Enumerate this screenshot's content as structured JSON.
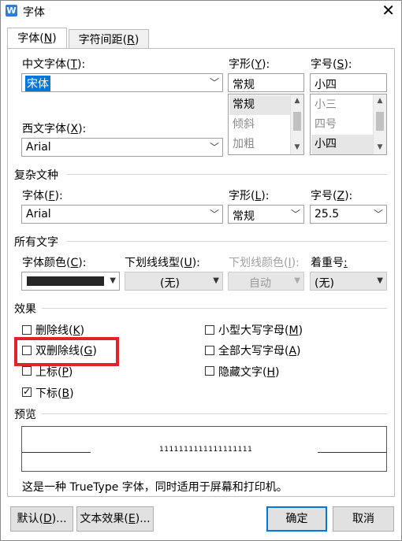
{
  "window": {
    "title": "字体",
    "app_icon": "W",
    "close_glyph": "✕"
  },
  "tabs": [
    {
      "label": "字体(",
      "key": "N",
      "suffix": ")"
    },
    {
      "label": "字符间距(",
      "key": "R",
      "suffix": ")"
    }
  ],
  "chinese_font": {
    "label_pre": "中文字体(",
    "key": "T",
    "label_post": "):",
    "value": "宋体"
  },
  "western_font": {
    "label_pre": "西文字体(",
    "key": "X",
    "label_post": "):",
    "value": "Arial"
  },
  "style": {
    "label_pre": "字形(",
    "key": "Y",
    "label_post": "):",
    "value": "常规",
    "options": [
      "常规",
      "倾斜",
      "加粗"
    ]
  },
  "size": {
    "label_pre": "字号(",
    "key": "S",
    "label_post": "):",
    "value": "小四",
    "options": [
      "小三",
      "四号",
      "小四"
    ]
  },
  "complex": {
    "section": "复杂文种",
    "font_label_pre": "字体(",
    "font_key": "F",
    "font_label_post": "):",
    "font_value": "Arial",
    "style_label_pre": "字形(",
    "style_key": "L",
    "style_label_post": "):",
    "style_value": "常规",
    "size_label_pre": "字号(",
    "size_key": "Z",
    "size_label_post": "):",
    "size_value": "25.5"
  },
  "all_text": {
    "section": "所有文字",
    "color_label_pre": "字体颜色(",
    "color_key": "C",
    "color_label_post": "):",
    "color_value": "#262626",
    "underline_type_label_pre": "下划线线型(",
    "underline_type_key": "U",
    "underline_type_label_post": "):",
    "underline_type_value": "(无)",
    "underline_color_label_pre": "下划线颜色(",
    "underline_color_key": "I",
    "underline_color_label_post": "):",
    "underline_color_value": "自动",
    "emphasis_label_pre": "着重号",
    "emphasis_key": ":",
    "emphasis_value": "(无)"
  },
  "effects": {
    "section": "效果",
    "items": [
      {
        "pre": "删除线(",
        "key": "K",
        "post": ")",
        "checked": false
      },
      {
        "pre": "双删除线(",
        "key": "G",
        "post": ")",
        "checked": false
      },
      {
        "pre": "上标(",
        "key": "P",
        "post": ")",
        "checked": false
      },
      {
        "pre": "下标(",
        "key": "B",
        "post": ")",
        "checked": true
      },
      {
        "pre": "小型大写字母(",
        "key": "M",
        "post": ")",
        "checked": false
      },
      {
        "pre": "全部大写字母(",
        "key": "A",
        "post": ")",
        "checked": false
      },
      {
        "pre": "隐藏文字(",
        "key": "H",
        "post": ")",
        "checked": false
      }
    ]
  },
  "preview": {
    "section": "预览",
    "sample": "1111111111111111111",
    "note": "这是一种 TrueType 字体，同时适用于屏幕和打印机。"
  },
  "buttons": {
    "default_pre": "默认(",
    "default_key": "D",
    "default_post": ")...",
    "text_effects_pre": "文本效果(",
    "text_effects_key": "E",
    "text_effects_post": ")...",
    "ok": "确定",
    "cancel": "取消"
  },
  "colors": {
    "highlight_box": "#e0222a",
    "selection": "#0078d7",
    "disabled": "#e6e6e6"
  }
}
